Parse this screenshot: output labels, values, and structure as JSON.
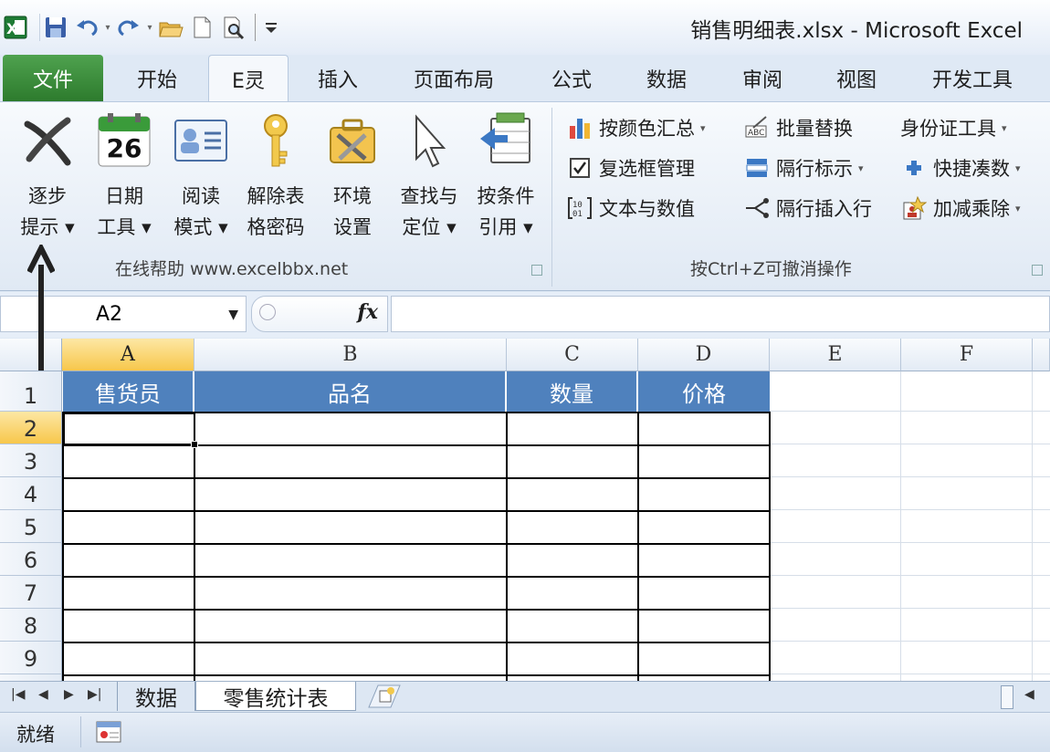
{
  "window": {
    "title": "销售明细表.xlsx  -  Microsoft Excel"
  },
  "qat": {
    "icons": [
      "excel-logo-icon",
      "save-icon",
      "undo-icon",
      "redo-icon",
      "open-folder-icon",
      "new-doc-icon",
      "print-preview-icon",
      "customize-qat-icon"
    ]
  },
  "tabs": [
    "文件",
    "开始",
    "E灵",
    "插入",
    "页面布局",
    "公式",
    "数据",
    "审阅",
    "视图",
    "开发工具"
  ],
  "ribbon": {
    "group1": {
      "buttons": [
        {
          "line1": "逐步",
          "line2": "提示 ▾"
        },
        {
          "line1": "日期",
          "line2": "工具 ▾",
          "calendar_number": "26"
        },
        {
          "line1": "阅读",
          "line2": "模式 ▾"
        },
        {
          "line1": "解除表",
          "line2": "格密码"
        },
        {
          "line1": "环境",
          "line2": "设置"
        },
        {
          "line1": "查找与",
          "line2": "定位 ▾"
        },
        {
          "line1": "按条件",
          "line2": "引用 ▾"
        }
      ],
      "label": "在线帮助   www.excelbbx.net"
    },
    "group2": {
      "items": [
        {
          "label": "按颜色汇总",
          "dropdown": true
        },
        {
          "label": "批量替换",
          "dropdown": false
        },
        {
          "label": "身份证工具",
          "dropdown": true
        },
        {
          "label": "复选框管理",
          "dropdown": false
        },
        {
          "label": "隔行标示",
          "dropdown": true
        },
        {
          "label": "快捷凑数",
          "dropdown": true
        },
        {
          "label": "文本与数值",
          "dropdown": false
        },
        {
          "label": "隔行插入行",
          "dropdown": false
        },
        {
          "label": "加减乘除",
          "dropdown": true
        }
      ],
      "label": "按Ctrl+Z可撤消操作"
    }
  },
  "formula_bar": {
    "name_box": "A2",
    "fx": "fx",
    "value": ""
  },
  "sheet": {
    "columns": [
      "A",
      "B",
      "C",
      "D",
      "E",
      "F"
    ],
    "rows": [
      "1",
      "2",
      "3",
      "4",
      "5",
      "6",
      "7",
      "8",
      "9"
    ],
    "headers": [
      "售货员",
      "品名",
      "数量",
      "价格"
    ],
    "selected_cell": "A2"
  },
  "sheet_tabs": [
    "数据",
    "零售统计表"
  ],
  "status": {
    "text": "就绪"
  },
  "colors": {
    "header_fill": "#4f81bd",
    "file_tab": "#2c7a2c",
    "selected_header": "#f7c74b"
  }
}
